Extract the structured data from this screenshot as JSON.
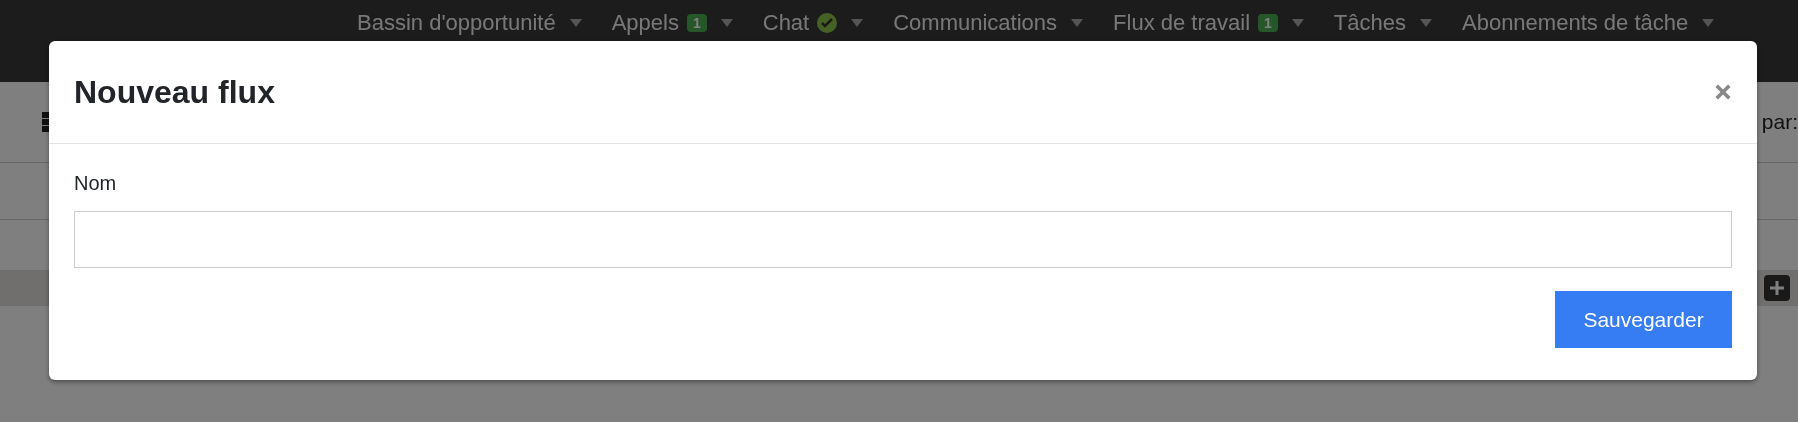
{
  "nav": {
    "items": [
      {
        "label": "Bassin d'opportunité"
      },
      {
        "label": "Appels",
        "badge": "1"
      },
      {
        "label": "Chat",
        "verified": true
      },
      {
        "label": "Communications"
      },
      {
        "label": "Flux de travail",
        "badge": "1"
      },
      {
        "label": "Tâches"
      },
      {
        "label": "Abonnements de tâche"
      }
    ]
  },
  "page": {
    "sort_label": "par:"
  },
  "modal": {
    "title": "Nouveau flux",
    "field": {
      "label": "Nom"
    },
    "save_button": "Sauvegarder"
  }
}
